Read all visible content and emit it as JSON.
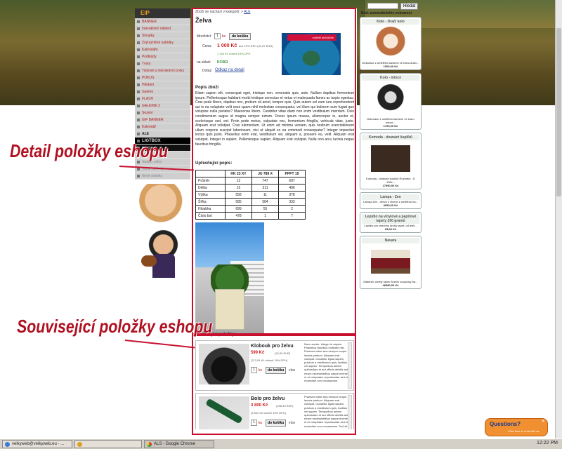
{
  "search": {
    "placeholder": "",
    "button": "Hledat"
  },
  "leftnav": {
    "logo": "EIP",
    "items": [
      "BANNER",
      "Interaktivní náhled",
      "Sloupky",
      "Zvýrazněné nabídky",
      "Kalendáře",
      "Podklady",
      "Tvary",
      "Tiskové a interaktivní prvky",
      "POKUS",
      "Hledání",
      "Galerie",
      "FLASH",
      "GALERIE 2",
      "Sezení",
      "GIF BANNER",
      "Kalendář",
      "ALE"
    ],
    "dark": [
      "LIGTBOX",
      "input"
    ],
    "bottom": [
      "Nové",
      "Nadpis sekcí",
      "Volné náhledy",
      "Nové stránky"
    ]
  },
  "breadcrumb": {
    "text": "Zboží se nachází v kategorii: > ",
    "link": "ALE"
  },
  "product": {
    "title": "Želva",
    "qty_label": "Množství:",
    "qty": "1",
    "ks": "ks",
    "add_button": "do košíku",
    "price_label": "Cena:",
    "price": "1 000 Kč",
    "price_note": "bez 19% DPH (41,87 EUR)",
    "price_vat": "1 190 Kč včetně 19% DPH",
    "stock_label": "na sklad:",
    "stock": "KC001",
    "inquiry_label": "Dotaz:",
    "inquiry_link": "Odkaz na detail",
    "banner": "zvláště akčňáček"
  },
  "description": {
    "heading": "Popis zboží",
    "text": "Etiam sapien elit, consequat eget, tristique non, venenatis quis, ante. Nullam dapibus fermentum ipsum. Pellentesque habitant morbi tristique senectus et netus et malesuada fames ac turpis egestas. Cras pede libero, dapibus nec, pretium sit amet, tempor quis. Quis autem vel eum iure reprehenderit qui in ea voluptate velit esse quam nihil molestiae consequatur, vel illum qui dolorem eum fugiat quo voluptas nulla pariatur? Maecenas libero. Curabitur vitae diam non enim vestibulum interdum. Duis condimentum augue id magna semper rutrum. Donec ipsum massa, ullamcorper in, auctor et, scelerisque sed, est. Proin pede metus, vulputate nec, fermentum fringilla, vehicula vitae, justo. Aliquam erat volutpat. Cras elementum. Ut enim ad minima veniam, quis nostrum exercitationem ullam corporis suscipit laboriosam, nisi ut aliquid ex ea commodi consequatur? Integer imperdiet lectus quis justo. Phasellus enim erat, vestibulum vel, aliquam a, posuere eu, velit. Aliquam erat volutpat. Integer in sapien. Pellentesque sapien. Aliquam erat volutpat. Nulla non arcu lacinia neque faucibus fringilla."
  },
  "specs": {
    "heading": "Upřesňující popis:",
    "columns": [
      "",
      "HK 23 XY",
      "JU 789 X",
      "PPPT 15"
    ],
    "rows": [
      [
        "Průměr",
        "12",
        "747",
        "697"
      ],
      [
        "Délka",
        "15",
        "311",
        "496"
      ],
      [
        "Výška",
        "558",
        "11",
        "378"
      ],
      [
        "Šířka",
        "585",
        "584",
        "333"
      ],
      [
        "Hloubka",
        "699",
        "55",
        "2"
      ],
      [
        "Číslo bot",
        "478",
        "1",
        "7"
      ]
    ]
  },
  "related": {
    "heading": "Související položky:",
    "items": [
      {
        "name": "Klobouk pro želvu",
        "price": "599 Kč",
        "sub1": "(24,90 EUR)",
        "sub2": "(712,81 Kč včetně 19% DPH)",
        "qty": "1",
        "ks": "ks",
        "add": "do košíku",
        "more": "více",
        "desc": "Nunc auctor. Integer in sapien. Phasellus faucibus molestie nisl. Praesent vitae arcu tempor neque lacinia pretium. Aliquam erat volutpat. Curabitur ligula sapien, pulvinar a vestibulum quis, facilisis vel sapien. Temporibus autem quibusdam et aut officiis debitis aut rerum necessitatibus saepe eveniet ut et voluptates repudiandae sint et molestiae non recusandae."
      },
      {
        "name": "Bolo pro želvu",
        "price": "3 800 Kč",
        "sub1": "(158,33 EUR)",
        "sub2": "(4 522 Kč včetně 19% DPH)",
        "qty": "1",
        "ks": "ks",
        "add": "do košíku",
        "more": "více",
        "desc": "Praesent vitae arcu tempor neque lacinia pretium. Aliquam erat volutpat. Curabitur ligula sapien, pulvinar a vestibulum quis, facilisis vel sapien. Temporibus autem quibusdam et aut officiis debitis aut rerum necessitatibus saepe eveniet ut et voluptates repudiandae sint et molestiae non recusandae. Sed sit est, perspiciatis a, tempor quis."
      }
    ]
  },
  "annotations": {
    "detail": "Detail položky eshopu",
    "related": "Související položky eshopu"
  },
  "sidebar": {
    "title": "Blok automatického zobrazení",
    "cards": [
      {
        "h": "Kolo - Dračí kolo",
        "t": "Dekorace z umělého kamene ve tvaru dračí...",
        "p": "1500,00 Kč"
      },
      {
        "h": "Kolo - mince",
        "t": "Dekorace z umělého kamene ve tvaru mince...",
        "p": "1700,00 Kč"
      },
      {
        "h": "Komoda - dvanáct šuplíků",
        "t": "Komoda - dvanáct šuplíků Rozměry - D 138x...",
        "p": "17990,00 Kč"
      },
      {
        "h": "Lampa - Zen",
        "t": "Lampa Zen - dřevo s čtverci z umělého ka...",
        "p": "4990,00 Kč"
      },
      {
        "h": "Lepidlo na vinylové a papírové tapety 200 gramů",
        "t": "Lepidlo pro všechny druhy tapet, od lehk...",
        "p": "83,00 Kč"
      },
      {
        "h": "Navara",
        "t": "Materiál: umělý ratan Sezení soupravy ha...",
        "p": "46980,00 Kč"
      }
    ]
  },
  "questions": {
    "title": "Questions?",
    "sub": "Click here to chat with us",
    "close": "×"
  },
  "taskbar": {
    "items": [
      "velkyweb@velkyweb.eu - ...",
      "",
      "ALS - Google Chrome"
    ],
    "clock": "12:22 PM"
  }
}
